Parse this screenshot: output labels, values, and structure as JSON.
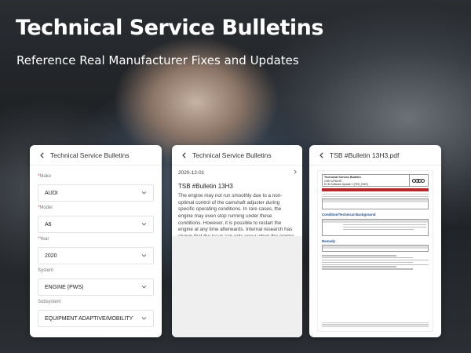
{
  "hero": {
    "title": "Technical Service Bulletins",
    "subtitle": "Reference Real Manufacturer Fixes and Updates"
  },
  "card1": {
    "header": "Technical Service Bulletins",
    "fields": [
      {
        "label": "Make",
        "required": true,
        "value": "AUDI"
      },
      {
        "label": "Model",
        "required": true,
        "value": "A6"
      },
      {
        "label": "Year",
        "required": true,
        "value": "2020"
      },
      {
        "label": "System",
        "required": false,
        "value": "ENGINE (PWS)"
      },
      {
        "label": "Subsystem",
        "required": false,
        "value": "EQUIPMENT ADAPTIVE/MOBILITY"
      }
    ]
  },
  "card2": {
    "header": "Technical Service Bulletins",
    "date": "2020-12-01",
    "bulletin_title": "TSB #Bulletin 13H3",
    "body": "The engine may not run smoothly due to a non-optimal control of the camshaft adjuster during specific operating conditions. In rare cases, the engine may even stop running under these conditions. However, it is possible to restart the engine at any time afterwards. Internal research has shown that the issue can only occur when the engine is idling (i.e. when the vehicle is stationary or just before the vehicle comes to a stop)."
  },
  "card3": {
    "header": "TSB #Bulletin 13H3.pdf",
    "pdf": {
      "doc_title": "Technical Service Bulletin",
      "bulletin_code": "13H3 UPDATE",
      "bulletin_subject": "ECM Software Update » (FED_EMS)",
      "section_background": "Condition/Technical Background",
      "section_remedy": "Remedy"
    }
  },
  "colors": {
    "accent_red": "#e53935",
    "pdf_heading_blue": "#1f4e8c",
    "pdf_table_red": "#b8262a"
  }
}
